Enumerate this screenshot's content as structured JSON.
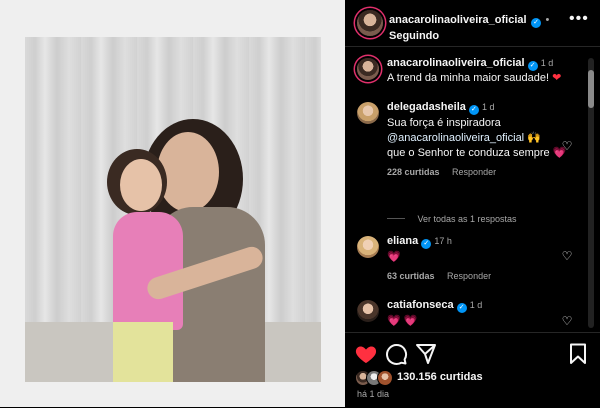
{
  "post": {
    "author": "anacarolinaoliveira_oficial",
    "follow_status": "Seguindo",
    "more_icon": "ellipsis-icon"
  },
  "caption": {
    "username": "anacarolinaoliveira_oficial",
    "time": "1 d",
    "text": "A trend da minha maior saudade!",
    "emoji": "❤"
  },
  "comments": [
    {
      "username": "delegadasheila",
      "time": "1 d",
      "text_before": "Sua força é inspiradora",
      "mention": "@anacarolinaoliveira_oficial",
      "emoji1": "🙌",
      "text_after": "que o Senhor te conduza sempre",
      "emoji2": "💗",
      "likes": "228 curtidas",
      "reply": "Responder",
      "view_replies": "Ver todas as 1 respostas"
    },
    {
      "username": "eliana",
      "time": "17 h",
      "emoji": "💗",
      "likes": "63 curtidas",
      "reply": "Responder"
    },
    {
      "username": "catiafonseca",
      "time": "1 d",
      "emoji": "💗 💗"
    }
  ],
  "footer": {
    "likes": "130.156 curtidas",
    "posted": "há 1 dia"
  },
  "colors": {
    "background": "#000000",
    "accent_blue": "#0095f6",
    "like_red": "#ff3040",
    "muted": "#a8a8a8"
  }
}
